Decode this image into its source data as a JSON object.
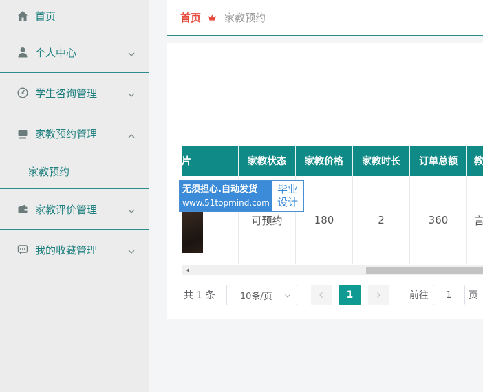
{
  "sidebar": {
    "items": [
      {
        "label": "首页",
        "icon": "home-icon"
      },
      {
        "label": "个人中心",
        "icon": "user-icon"
      },
      {
        "label": "学生咨询管理",
        "icon": "gauge-icon"
      },
      {
        "label": "家教预约管理",
        "icon": "monitor-icon",
        "submenu": [
          {
            "label": "家教预约"
          }
        ]
      },
      {
        "label": "家教评价管理",
        "icon": "wallet-icon"
      },
      {
        "label": "我的收藏管理",
        "icon": "chat-icon"
      }
    ]
  },
  "breadcrumb": {
    "home": "首页",
    "current": "家教预约"
  },
  "table": {
    "columns": [
      "片",
      "家教状态",
      "家教价格",
      "家教时长",
      "订单总额",
      "教"
    ],
    "rows": [
      {
        "status": "可预约",
        "price": "180",
        "duration": "2",
        "total": "360",
        "last": "言"
      }
    ]
  },
  "watermark": {
    "line1": "无须担心.自动发货",
    "line2": "www.51topmind.com",
    "right1": "毕业",
    "right2": "设计"
  },
  "pagination": {
    "total": "共 1 条",
    "page_size": "10条/页",
    "current_page": "1",
    "goto_label": "前往",
    "goto_value": "1",
    "goto_suffix": "页"
  },
  "colors": {
    "accent": "#0f8a87",
    "home_red": "#e4493b",
    "watermark_blue": "#3b8bd8"
  }
}
